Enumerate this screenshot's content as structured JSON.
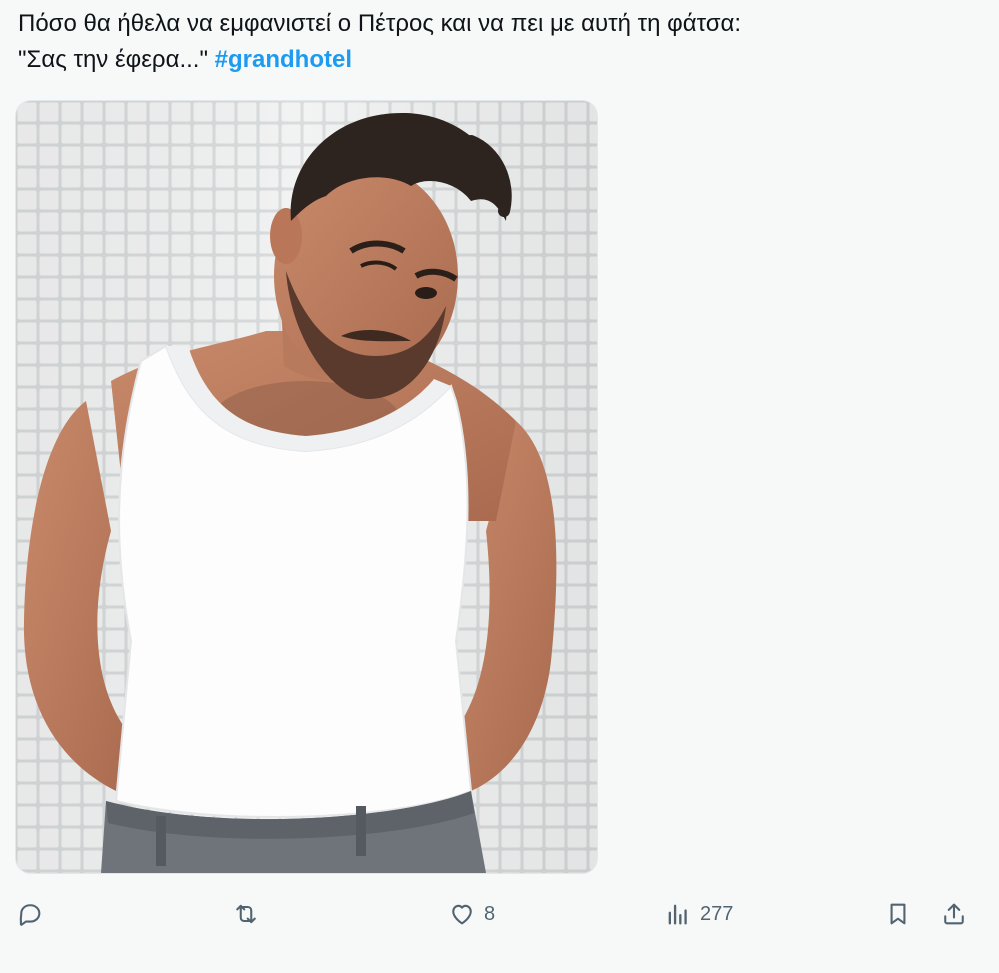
{
  "tweet": {
    "text_line1": "Πόσο θα ήθελα να εμφανιστεί ο Πέτρος και να πει με αυτή τη φάτσα:",
    "text_line2": "\"Σας την έφερα...\"",
    "hashtag": "#grandhotel"
  },
  "media": {
    "icon": "photo-of-man-in-white-tank-top-winking"
  },
  "actions": {
    "reply_icon": "reply-icon",
    "retweet_icon": "retweet-icon",
    "like_icon": "heart-icon",
    "likes": "8",
    "views_icon": "views-chart-icon",
    "views": "277",
    "bookmark_icon": "bookmark-icon",
    "share_icon": "share-icon"
  },
  "colors": {
    "accent": "#1d9bf0",
    "text": "#0f1419",
    "muted": "#536471",
    "background": "#f7f9f9"
  }
}
